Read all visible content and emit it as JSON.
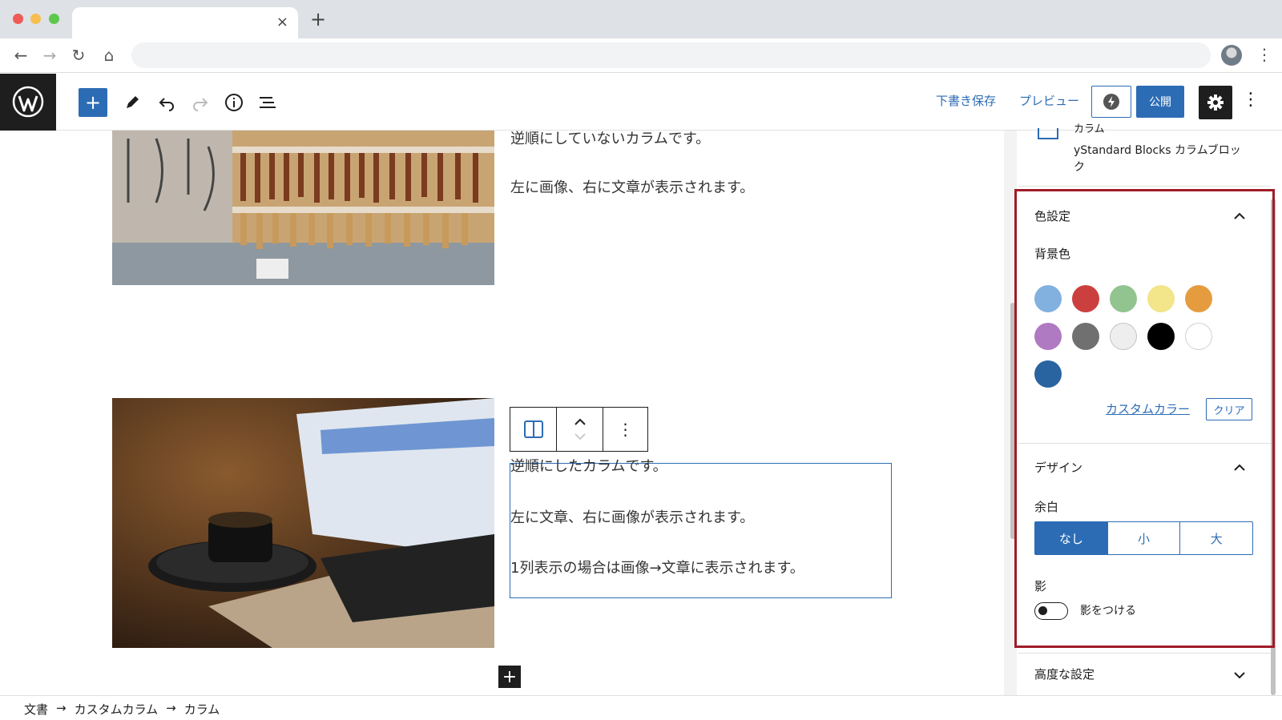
{
  "browser": {
    "tab_close": "×",
    "new_tab": "+",
    "omnibox_value": ""
  },
  "toolbar": {
    "add": "+",
    "save_draft": "下書き保存",
    "preview": "プレビュー",
    "publish": "公開",
    "more": "⋮"
  },
  "content": {
    "col1_line1": "逆順にしていないカラムです。",
    "col1_line2": "左に画像、右に文章が表示されます。",
    "col2_line1": "逆順にしたカラムです。",
    "col2_line2": "左に文章、右に画像が表示されます。",
    "col2_line3": "1列表示の場合は画像→文章に表示されます。"
  },
  "sidebar": {
    "block_name": "カラム",
    "block_desc": "yStandard Blocks カラムブロック",
    "color_panel_title": "色設定",
    "bg_label": "背景色",
    "swatches": [
      "#82b1e0",
      "#cc3f3f",
      "#92c48f",
      "#f2e58a",
      "#e59c3f",
      "#b07ac2",
      "#707070",
      "#eeeeee",
      "#000000",
      "#ffffff",
      "#2a64a0"
    ],
    "custom_color": "カスタムカラー",
    "clear": "クリア",
    "design_panel_title": "デザイン",
    "padding_label": "余白",
    "padding_options": [
      "なし",
      "小",
      "大"
    ],
    "padding_selected": "なし",
    "shadow_label": "影",
    "shadow_toggle_label": "影をつける",
    "shadow_on": false,
    "advanced_title": "高度な設定"
  },
  "breadcrumb": {
    "items": [
      "文書",
      "カスタムカラム",
      "カラム"
    ],
    "separator": "→"
  },
  "colors": {
    "accent": "#2c6cb5",
    "highlight": "#a01c27"
  }
}
